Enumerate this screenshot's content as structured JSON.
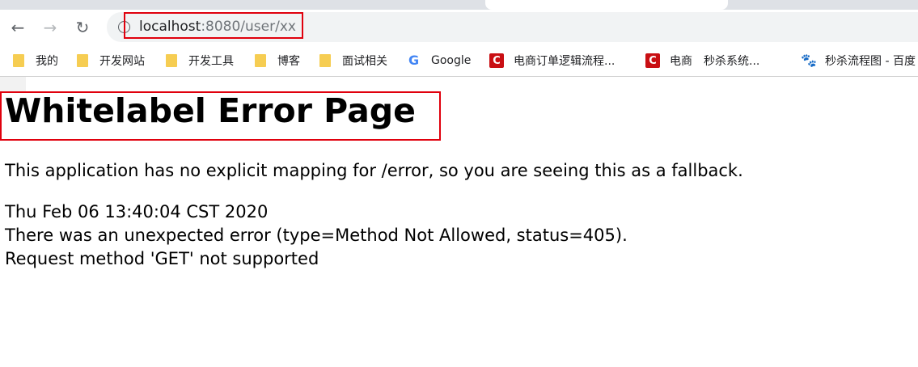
{
  "browser": {
    "url_host": "localhost",
    "url_rest": ":8080/user/xx",
    "nav": {
      "back_glyph": "←",
      "forward_glyph": "→",
      "reload_glyph": "↻"
    }
  },
  "bookmarks": [
    {
      "label": "我的",
      "icon": "folder-icon"
    },
    {
      "label": "开发网站",
      "icon": "folder-icon"
    },
    {
      "label": "开发工具",
      "icon": "folder-icon"
    },
    {
      "label": "博客",
      "icon": "folder-icon"
    },
    {
      "label": "面试相关",
      "icon": "folder-icon"
    },
    {
      "label": "Google",
      "icon": "google-icon"
    },
    {
      "label": "电商订单逻辑流程...",
      "icon": "csdn-icon"
    },
    {
      "label": "电商　秒杀系统...",
      "icon": "csdn-icon"
    },
    {
      "label": "秒杀流程图 - 百度",
      "icon": "baidu-icon"
    }
  ],
  "page": {
    "title": "Whitelabel Error Page",
    "fallback_message": "This application has no explicit mapping for /error, so you are seeing this as a fallback.",
    "timestamp": "Thu Feb 06 13:40:04 CST 2020",
    "error_line": "There was an unexpected error (type=Method Not Allowed, status=405).",
    "detail_line": "Request method 'GET' not supported"
  },
  "colors": {
    "highlight": "#e0000d",
    "tabstrip": "#dee1e6",
    "omnibox": "#f1f3f4",
    "folder": "#f6cd52",
    "csdn": "#c90f13"
  }
}
